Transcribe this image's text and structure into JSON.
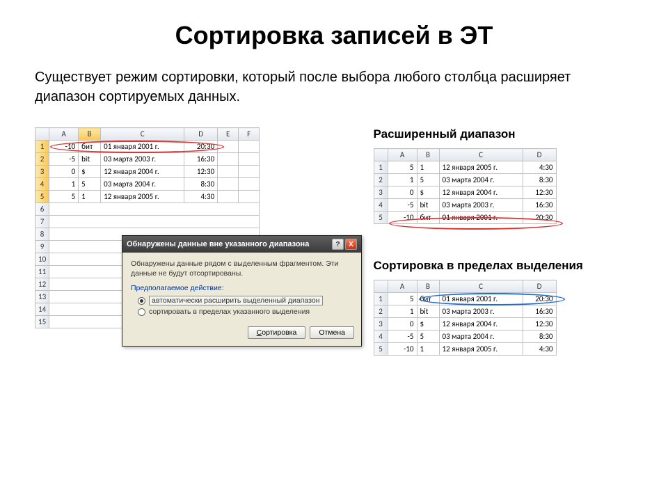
{
  "title": "Сортировка записей в ЭТ",
  "subtitle": "Существует режим сортировки, который после выбора любого столбца расширяет диапазон сортируемых данных.",
  "sections": {
    "extended": "Расширенный диапазон",
    "within": "Сортировка в пределах выделения"
  },
  "cols": [
    "A",
    "B",
    "C",
    "D",
    "E",
    "F"
  ],
  "rowNums": [
    "1",
    "2",
    "3",
    "4",
    "5",
    "6",
    "7",
    "8",
    "9",
    "10",
    "11",
    "12",
    "13",
    "14",
    "15"
  ],
  "table1": [
    {
      "a": "-10",
      "b": "бит",
      "c": "01 января 2001 г.",
      "d": "20:30"
    },
    {
      "a": "-5",
      "b": "bit",
      "c": "03 марта 2003 г.",
      "d": "16:30"
    },
    {
      "a": "0",
      "b": "$",
      "c": "12 января 2004 г.",
      "d": "12:30"
    },
    {
      "a": "1",
      "b": "5",
      "c": "03 марта 2004 г.",
      "d": "8:30"
    },
    {
      "a": "5",
      "b": "1",
      "c": "12 января 2005 г.",
      "d": "4:30"
    }
  ],
  "table2": [
    {
      "a": "5",
      "b": "1",
      "c": "12 января 2005 г.",
      "d": "4:30"
    },
    {
      "a": "1",
      "b": "5",
      "c": "03 марта 2004 г.",
      "d": "8:30"
    },
    {
      "a": "0",
      "b": "$",
      "c": "12 января 2004 г.",
      "d": "12:30"
    },
    {
      "a": "-5",
      "b": "bit",
      "c": "03 марта 2003 г.",
      "d": "16:30"
    },
    {
      "a": "-10",
      "b": "бит",
      "c": "01 января 2001 г.",
      "d": "20:30"
    }
  ],
  "table3": [
    {
      "a": "5",
      "b": "бит",
      "c": "01 января 2001 г.",
      "d": "20:30"
    },
    {
      "a": "1",
      "b": "bit",
      "c": "03 марта 2003 г.",
      "d": "16:30"
    },
    {
      "a": "0",
      "b": "$",
      "c": "12 января 2004 г.",
      "d": "12:30"
    },
    {
      "a": "-5",
      "b": "5",
      "c": "03 марта 2004 г.",
      "d": "8:30"
    },
    {
      "a": "-10",
      "b": "1",
      "c": "12 января 2005 г.",
      "d": "4:30"
    }
  ],
  "dialog": {
    "title": "Обнаружены данные вне указанного диапазона",
    "msg": "Обнаружены данные рядом с выделенным фрагментом. Эти данные не будут отсортированы.",
    "section": "Предполагаемое действие:",
    "opt1": "автоматически расширить выделенный диапазон",
    "opt2": "сортировать в пределах указанного выделения",
    "sort": "Сортировка",
    "cancel": "Отмена",
    "sortU": "С",
    "help": "?",
    "close": "X"
  }
}
